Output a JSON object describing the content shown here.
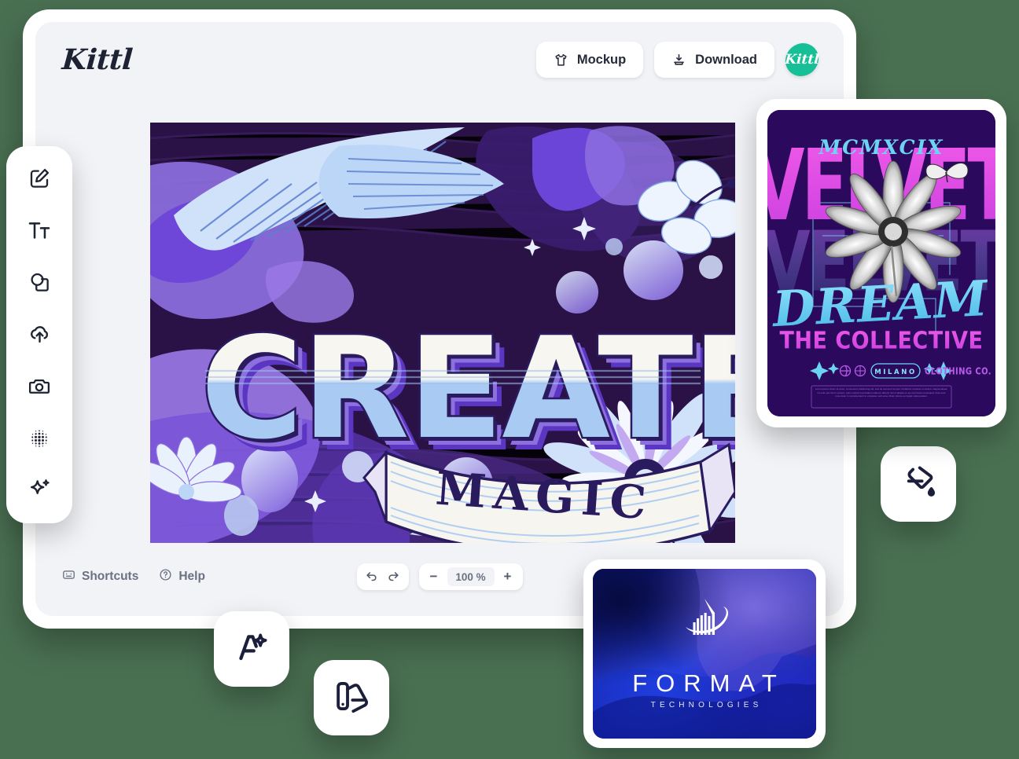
{
  "app": {
    "brand": "Kittl",
    "avatar_label": "Kittl"
  },
  "toolbar_top": {
    "mockup_label": "Mockup",
    "mockup_icon": "tshirt-icon",
    "download_label": "Download",
    "download_icon": "download-icon"
  },
  "tool_rail": {
    "items": [
      {
        "name": "edit-tool",
        "icon": "pencil-square-icon"
      },
      {
        "name": "text-tool",
        "icon": "text-tt-icon"
      },
      {
        "name": "shapes-tool",
        "icon": "shapes-icon"
      },
      {
        "name": "upload-tool",
        "icon": "cloud-upload-icon"
      },
      {
        "name": "photos-tool",
        "icon": "camera-icon"
      },
      {
        "name": "texture-tool",
        "icon": "halftone-dots-icon"
      },
      {
        "name": "effects-tool",
        "icon": "sparkle-icon"
      }
    ]
  },
  "bottombar": {
    "shortcuts_label": "Shortcuts",
    "shortcuts_icon": "keyboard-icon",
    "help_label": "Help",
    "help_icon": "question-circle-icon",
    "undo_icon": "undo-arrow-icon",
    "redo_icon": "redo-arrow-icon",
    "zoom_out_label": "−",
    "zoom_in_label": "+",
    "zoom_value": "100 %"
  },
  "canvas": {
    "headline": "CREATE",
    "banner_text": "MAGIC",
    "colors": {
      "background": "#2a1246",
      "lavender": "#9b7ae8",
      "violet": "#6b44d8",
      "light_blue": "#a8c8f0",
      "cream": "#f6f5ef",
      "navy": "#2a1a5e"
    }
  },
  "floating_cards": [
    {
      "name": "ai-text-card",
      "icon": "letter-a-sparkle-icon"
    },
    {
      "name": "color-swatch-card",
      "icon": "swatch-fan-icon"
    },
    {
      "name": "fill-tool-card",
      "icon": "paint-bucket-icon"
    }
  ],
  "poster_card": {
    "eyebrow": "MCMXCIX",
    "title": "VELVET",
    "subtitle": "DREAM",
    "tagline": "THE COLLECTIVE",
    "badge": "MILANO",
    "imprint": "CLOTHING CO.",
    "body_text": "Lorem ipsum dolor sit amet, consectetur adipiscing elit, sed do eiusmod tempor incididunt ut labore et dolore magna aliqua. Ut enim ad minim veniam, quis nostrud exercitation ullamco laboris nisi ut aliquip ex ea commodo consequat. Duis aute irure dolor in reprehenderit in voluptate velit esse cillum dolore eu fugiat nulla pariatur.",
    "colors": {
      "background": "#2b0a5d",
      "magenta": "#e243e0",
      "cyan": "#6cd4f2"
    }
  },
  "format_card": {
    "word": "FORMAT",
    "subword": "TECHNOLOGIES",
    "logo_icon": "building-orbit-icon",
    "colors": {
      "deep_blue": "#0a1060",
      "electric_blue": "#2b3ce0"
    }
  }
}
